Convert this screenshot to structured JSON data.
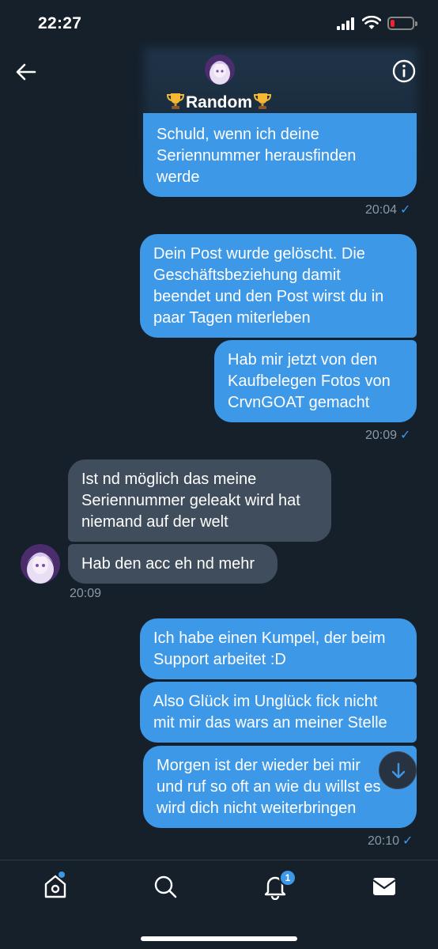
{
  "status_bar": {
    "time": "22:27",
    "icons": [
      "signal-icon",
      "wifi-icon",
      "battery-low-icon"
    ]
  },
  "header": {
    "title": "Random",
    "title_decoration": "trophy-icon"
  },
  "messages": [
    {
      "direction": "out",
      "lines": [
        "Schuld, wenn ich deine",
        "Seriennummer herausfinden",
        "werde"
      ]
    },
    {
      "direction": "out",
      "time": "20:04",
      "check": "✓"
    },
    {
      "direction": "out",
      "lines": [
        "Dein Post wurde gelöscht. Die",
        "Geschäftsbeziehung damit",
        "beendet und den Post wirst du in",
        "paar Tagen miterleben"
      ]
    },
    {
      "direction": "out",
      "lines": [
        "Hab mir jetzt von den",
        "Kaufbelegen Fotos von",
        "CrvnGOAT gemacht"
      ]
    },
    {
      "direction": "out",
      "time": "20:09",
      "check": "✓"
    },
    {
      "direction": "in",
      "lines": [
        "Ist nd möglich das meine",
        "Seriennummer geleakt wird hat",
        "niemand auf der welt"
      ]
    },
    {
      "direction": "in",
      "lines": [
        "Hab den acc eh nd mehr"
      ]
    },
    {
      "direction": "in",
      "time": "20:09"
    },
    {
      "direction": "out",
      "lines": [
        "Ich habe einen Kumpel, der beim",
        "Support arbeitet :D"
      ]
    },
    {
      "direction": "out",
      "lines": [
        "Also Glück im Unglück fick nicht",
        "mit mir das wars an meiner Stelle"
      ]
    },
    {
      "direction": "out",
      "lines": [
        "Morgen ist der wieder bei mir",
        "und ruf so oft an wie du willst es",
        "wird dich nicht weiterbringen"
      ]
    },
    {
      "direction": "out",
      "time": "20:10",
      "check": "✓"
    }
  ],
  "bottom_nav": {
    "items": [
      "home-icon",
      "search-icon",
      "notifications-icon",
      "messages-icon"
    ],
    "notifications_badge": "1"
  },
  "colors": {
    "background": "#15202b",
    "outgoing_bubble": "#3e98e8",
    "incoming_bubble": "#3f4d5c",
    "meta_text": "#8b98a5",
    "accent": "#3e98e8"
  }
}
